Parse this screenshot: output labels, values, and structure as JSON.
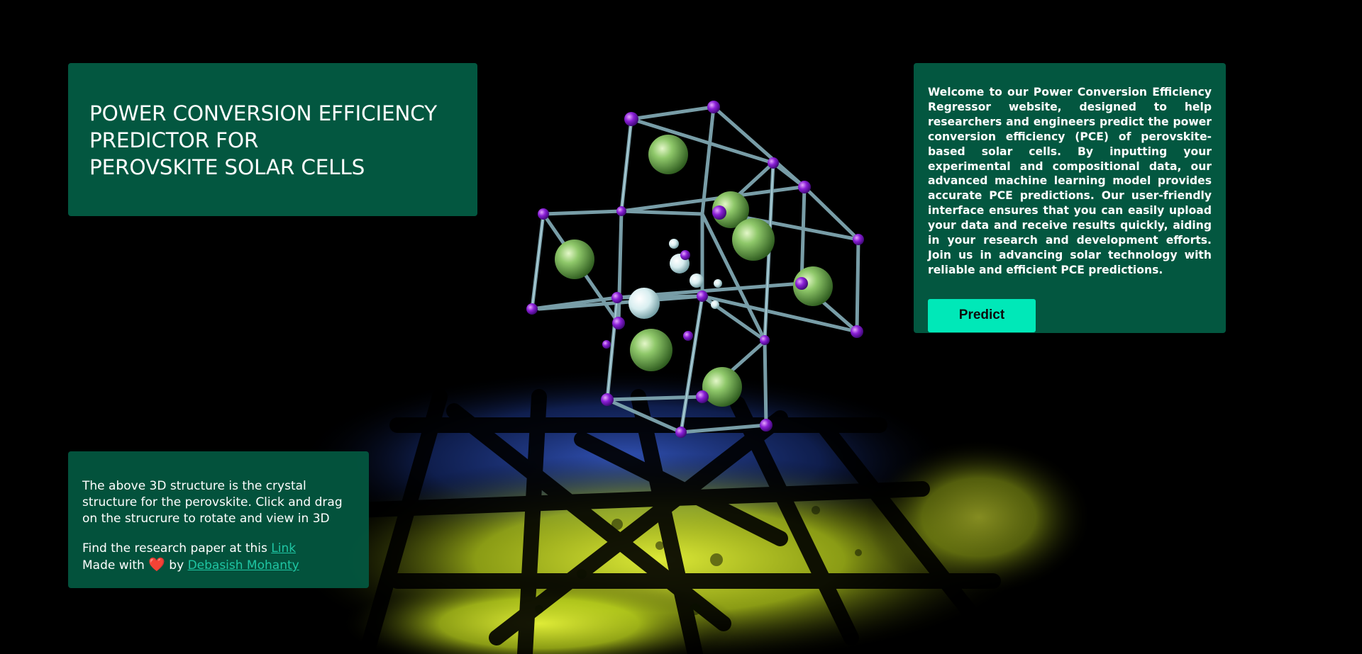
{
  "header": {
    "title_lines": [
      "POWER CONVERSION EFFICIENCY",
      "PREDICTOR FOR",
      "PEROVSKITE SOLAR CELLS"
    ]
  },
  "intro": {
    "text": "Welcome to our Power Conversion Efficiency Regressor website, designed to help researchers and engineers predict the power conversion efficiency (PCE) of perovskite-based solar cells. By inputting your experimental and compositional data, our advanced machine learning model provides accurate PCE predictions. Our user-friendly interface ensures that you can easily upload your data and receive results quickly, aiding in your research and development efforts. Join us in advancing solar technology with reliable and efficient PCE predictions.",
    "predict_label": "Predict"
  },
  "note": {
    "description": "The above 3D structure is the crystal structure for the perovskite. Click and drag on the strucrure to rotate and view in 3D",
    "paper_prefix": "Find the research paper at this ",
    "paper_link_label": "Link",
    "made_with_prefix": "Made with ",
    "heart_glyph": "❤️",
    "made_with_by": " by ",
    "author_link_label": "Debasish Mohanty"
  },
  "viewer": {
    "icon": "crystal-structure-3d",
    "colors": {
      "background": "#000000",
      "panel": "#035740",
      "button": "#00e8b8",
      "link": "#1fc6a4",
      "atom_a": "#8fc86a",
      "atom_b": "#8a1fd6",
      "atom_c": "#d8eef0",
      "shadow_glow": "#d6ec2a"
    }
  }
}
